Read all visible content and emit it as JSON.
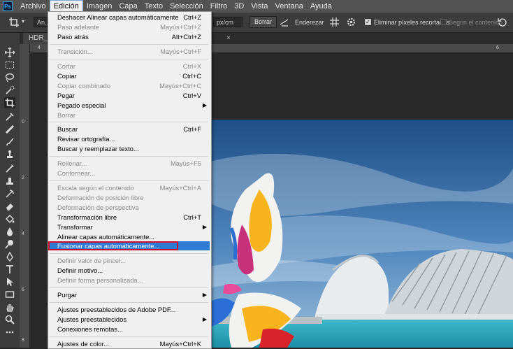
{
  "menubar": {
    "logo": "Ps",
    "items": [
      "Archivo",
      "Edición",
      "Imagen",
      "Capa",
      "Texto",
      "Selección",
      "Filtro",
      "3D",
      "Vista",
      "Ventana",
      "Ayuda"
    ]
  },
  "options": {
    "ratio_value": "An...",
    "unit_value": "px/cm",
    "clear_label": "Borrar",
    "straighten_label": "Enderezar",
    "delete_cropped_label": "Eliminar píxeles recortados",
    "content_aware_label": "Según el contenido"
  },
  "document": {
    "tab_label": "HDR_sin",
    "tab_close": "×"
  },
  "rulers": {
    "top": [
      "4",
      "6"
    ],
    "left": [
      "0",
      "2",
      "4",
      "6",
      "8"
    ]
  },
  "edit_menu": {
    "items": [
      {
        "label": "Deshacer Alinear capas automáticamente",
        "shortcut": "Ctrl+Z",
        "disabled": false
      },
      {
        "label": "Paso adelante",
        "shortcut": "Mayús+Ctrl+Z",
        "disabled": true
      },
      {
        "label": "Paso atrás",
        "shortcut": "Alt+Ctrl+Z",
        "disabled": false
      },
      {
        "label": "Transición...",
        "shortcut": "Mayús+Ctrl+F",
        "disabled": true
      },
      {
        "label": "Cortar",
        "shortcut": "Ctrl+X",
        "disabled": true
      },
      {
        "label": "Copiar",
        "shortcut": "Ctrl+C",
        "disabled": false
      },
      {
        "label": "Copiar combinado",
        "shortcut": "Mayús+Ctrl+C",
        "disabled": true
      },
      {
        "label": "Pegar",
        "shortcut": "Ctrl+V",
        "disabled": false
      },
      {
        "label": "Pegado especial",
        "shortcut": "",
        "disabled": false,
        "submenu": true
      },
      {
        "label": "Borrar",
        "shortcut": "",
        "disabled": true
      },
      {
        "label": "Buscar",
        "shortcut": "Ctrl+F",
        "disabled": false
      },
      {
        "label": "Revisar ortografía...",
        "shortcut": "",
        "disabled": false
      },
      {
        "label": "Buscar y reemplazar texto...",
        "shortcut": "",
        "disabled": false
      },
      {
        "label": "Rellenar...",
        "shortcut": "Mayús+F5",
        "disabled": true
      },
      {
        "label": "Contornear...",
        "shortcut": "",
        "disabled": true
      },
      {
        "label": "Escala según el contenido",
        "shortcut": "Mayús+Ctrl+A",
        "disabled": true
      },
      {
        "label": "Deformación de posición libre",
        "shortcut": "",
        "disabled": true
      },
      {
        "label": "Deformación de perspectiva",
        "shortcut": "",
        "disabled": true
      },
      {
        "label": "Transformación libre",
        "shortcut": "Ctrl+T",
        "disabled": false
      },
      {
        "label": "Transformar",
        "shortcut": "",
        "disabled": false,
        "submenu": true
      },
      {
        "label": "Alinear capas automáticamente...",
        "shortcut": "",
        "disabled": false
      },
      {
        "label": "Fusionar capas automáticamente...",
        "shortcut": "",
        "disabled": false,
        "highlighted": true
      },
      {
        "label": "Definir valor de pincel...",
        "shortcut": "",
        "disabled": true
      },
      {
        "label": "Definir motivo...",
        "shortcut": "",
        "disabled": false
      },
      {
        "label": "Definir forma personalizada...",
        "shortcut": "",
        "disabled": true
      },
      {
        "label": "Purgar",
        "shortcut": "",
        "disabled": false,
        "submenu": true
      },
      {
        "label": "Ajustes preestablecidos de Adobe PDF...",
        "shortcut": "",
        "disabled": false
      },
      {
        "label": "Ajustes preestablecidos",
        "shortcut": "",
        "disabled": false,
        "submenu": true
      },
      {
        "label": "Conexiones remotas...",
        "shortcut": "",
        "disabled": false
      },
      {
        "label": "Ajustes de color...",
        "shortcut": "Mayús+Ctrl+K",
        "disabled": false
      }
    ]
  },
  "colors": {
    "highlight": "#2d7bd4",
    "highlight_border": "#c8102e",
    "app_bg": "#282828"
  }
}
